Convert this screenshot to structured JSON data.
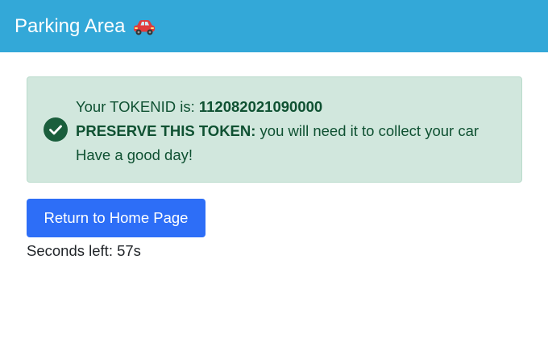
{
  "navbar": {
    "brand": "Parking Area",
    "brand_icon": "car-icon"
  },
  "alert": {
    "icon": "check-circle-icon",
    "token_prefix": "Your TOKENID is: ",
    "token_id": "112082021090000",
    "preserve_label": "PRESERVE THIS TOKEN:",
    "preserve_text": " you will need it to collect your car",
    "farewell": "Have a good day!",
    "colors": {
      "background": "#d1e7dd",
      "text": "#0f5132"
    }
  },
  "home_button": {
    "label": "Return to Home Page",
    "color": "#2d6ef7"
  },
  "countdown": {
    "prefix": "Seconds left: ",
    "value": "57s"
  },
  "colors": {
    "navbar": "#33a8d8"
  }
}
